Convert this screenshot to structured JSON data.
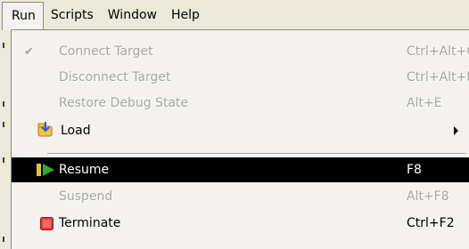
{
  "menubar": {
    "items": [
      "Run",
      "Scripts",
      "Window",
      "Help"
    ]
  },
  "run_menu": {
    "items": [
      {
        "label": "Connect Target",
        "shortcut": "Ctrl+Alt+C",
        "state": "disabled",
        "checked": true
      },
      {
        "label": "Disconnect Target",
        "shortcut": "Ctrl+Alt+D",
        "state": "disabled"
      },
      {
        "label": "Restore Debug State",
        "shortcut": "Alt+E",
        "state": "disabled"
      },
      {
        "label": "Load",
        "shortcut": "",
        "state": "enabled",
        "icon": "load-icon",
        "submenu": true
      },
      {
        "label": "Resume",
        "shortcut": "F8",
        "state": "selected",
        "icon": "resume-icon"
      },
      {
        "label": "Suspend",
        "shortcut": "Alt+F8",
        "state": "disabled"
      },
      {
        "label": "Terminate",
        "shortcut": "Ctrl+F2",
        "state": "enabled",
        "icon": "terminate-icon"
      }
    ]
  },
  "colors": {
    "highlight": "#000000",
    "disabled_text": "#a7a6a0",
    "menubar_bg": "#ece9d8",
    "menu_bg": "#f3f2ee",
    "terminate_red": "#e23a3a",
    "resume_green": "#2eaa2e"
  }
}
